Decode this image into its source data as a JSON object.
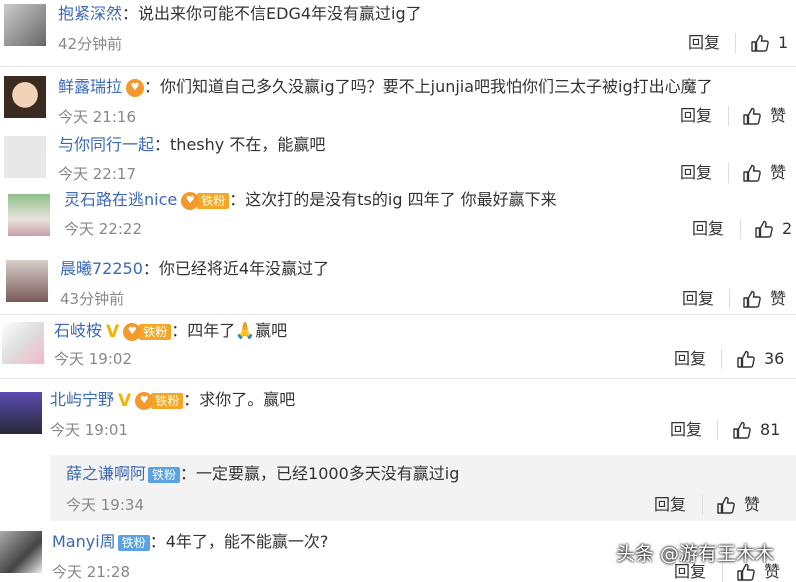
{
  "comments": [
    {
      "name": "抱紧深然",
      "text": "说出来你可能不信EDG4年没有赢过ig了",
      "time": "42分钟前",
      "reply": "回复",
      "like": "1"
    },
    {
      "name": "鲜露瑞拉",
      "text": "你们知道自己多久没赢ig了吗？要不上junjia吧我怕你们三太子被ig打出心魔了",
      "time": "今天 21:16",
      "reply": "回复",
      "like": "赞"
    },
    {
      "name": "与你同行一起",
      "text": "theshy 不在，能赢吧",
      "time": "今天 22:17",
      "reply": "回复",
      "like": "赞"
    },
    {
      "name": "灵石路在逃nice",
      "badge": "铁粉",
      "text": "这次打的是没有ts的ig 四年了 你最好赢下来",
      "time": "今天 22:22",
      "reply": "回复",
      "like": "2"
    },
    {
      "name": "晨曦72250",
      "text": "你已经将近4年没赢过了",
      "time": "43分钟前",
      "reply": "回复",
      "like": "赞"
    },
    {
      "name": "石岐桉",
      "badge": "铁粉",
      "text": "四年了🙏赢吧",
      "time": "今天 19:02",
      "reply": "回复",
      "like": "36"
    },
    {
      "name": "北屿宁野",
      "badge": "铁粉",
      "text": "求你了。赢吧",
      "time": "今天 19:01",
      "reply": "回复",
      "like": "81"
    },
    {
      "name": "薛之谦啊阿",
      "badge": "铁粉",
      "text": "一定要赢，已经1000多天没有赢过ig",
      "time": "今天 19:34",
      "reply": "回复",
      "like": "赞"
    },
    {
      "name": "Manyi周",
      "badge": "铁粉",
      "text": "4年了，能不能赢一次?",
      "time": "今天 21:28",
      "reply": "回复",
      "like": "赞"
    }
  ],
  "colon": "：",
  "watermark": "头条 @游有王木木",
  "colors": {
    "name": "#3a69b6",
    "badge_orange": "#f5a623",
    "badge_blue": "#5aa2e2",
    "vip": "#f1b400"
  }
}
